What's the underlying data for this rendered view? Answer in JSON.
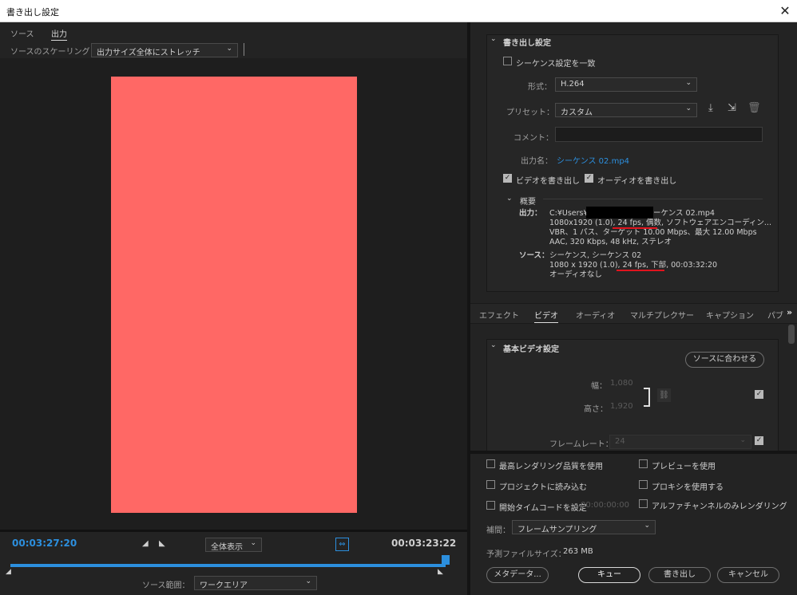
{
  "window": {
    "title": "書き出し設定",
    "close": "✕"
  },
  "left": {
    "tabs": [
      "ソース",
      "出力"
    ],
    "scaling_label": "ソースのスケーリング：",
    "scaling_value": "出力サイズ全体にストレッチ",
    "video_fill_color": "#ff6865",
    "timecode_current": "00:03:27:20",
    "timecode_end": "00:03:23:22",
    "zoom_value": "全体表示",
    "source_range_label": "ソース範囲：",
    "source_range_value": "ワークエリア"
  },
  "export": {
    "section_title": "書き出し設定",
    "match_sequence": "シーケンス設定を一致",
    "format_label": "形式：",
    "format_value": "H.264",
    "preset_label": "プリセット：",
    "preset_value": "カスタム",
    "comment_label": "コメント：",
    "comment_value": "",
    "output_name_label": "出力名：",
    "output_name_value": "シーケンス 02.mp4",
    "export_video": "ビデオを書き出し",
    "export_audio": "オーディオを書き出し",
    "summary_title": "概要",
    "output_label": "出力：",
    "output_lines": [
      "C:¥Users¥",
      "ーケンス 02.mp4",
      "1080x1920 (1.0), 24 fps, 偶数, ソフトウェアエンコーディン...",
      "VBR、1 パス、ターゲット 10.00 Mbps、最大 12.00 Mbps",
      "AAC, 320 Kbps, 48 kHz, ステレオ"
    ],
    "source_label": "ソース：",
    "source_lines": [
      "シーケンス, シーケンス 02",
      "1080 x 1920 (1.0), 24 fps, 下部, 00:03:32:20",
      "オーディオなし"
    ]
  },
  "tabs2": [
    "エフェクト",
    "ビデオ",
    "オーディオ",
    "マルチプレクサー",
    "キャプション",
    "パブ"
  ],
  "video": {
    "section_title": "基本ビデオ設定",
    "match_source": "ソースに合わせる",
    "width_label": "幅：",
    "width_value": "1,080",
    "height_label": "高さ：",
    "height_value": "1,920",
    "frame_rate_label": "フレームレート：",
    "frame_rate_value": "24"
  },
  "bottom": {
    "max_quality": "最高レンダリング品質を使用",
    "use_preview": "プレビューを使用",
    "import_project": "プロジェクトに読み込む",
    "use_proxy": "プロキシを使用する",
    "start_timecode": "開始タイムコードを設定",
    "start_timecode_value": "00:00:00:00",
    "alpha_only": "アルファチャンネルのみレンダリング",
    "interp_label": "補間：",
    "interp_value": "フレームサンプリング",
    "filesize_label": "予測ファイルサイズ：",
    "filesize_value": "263 MB",
    "metadata_button": "メタデータ...",
    "queue_button": "キュー",
    "export_button": "書き出し",
    "cancel_button": "キャンセル"
  }
}
